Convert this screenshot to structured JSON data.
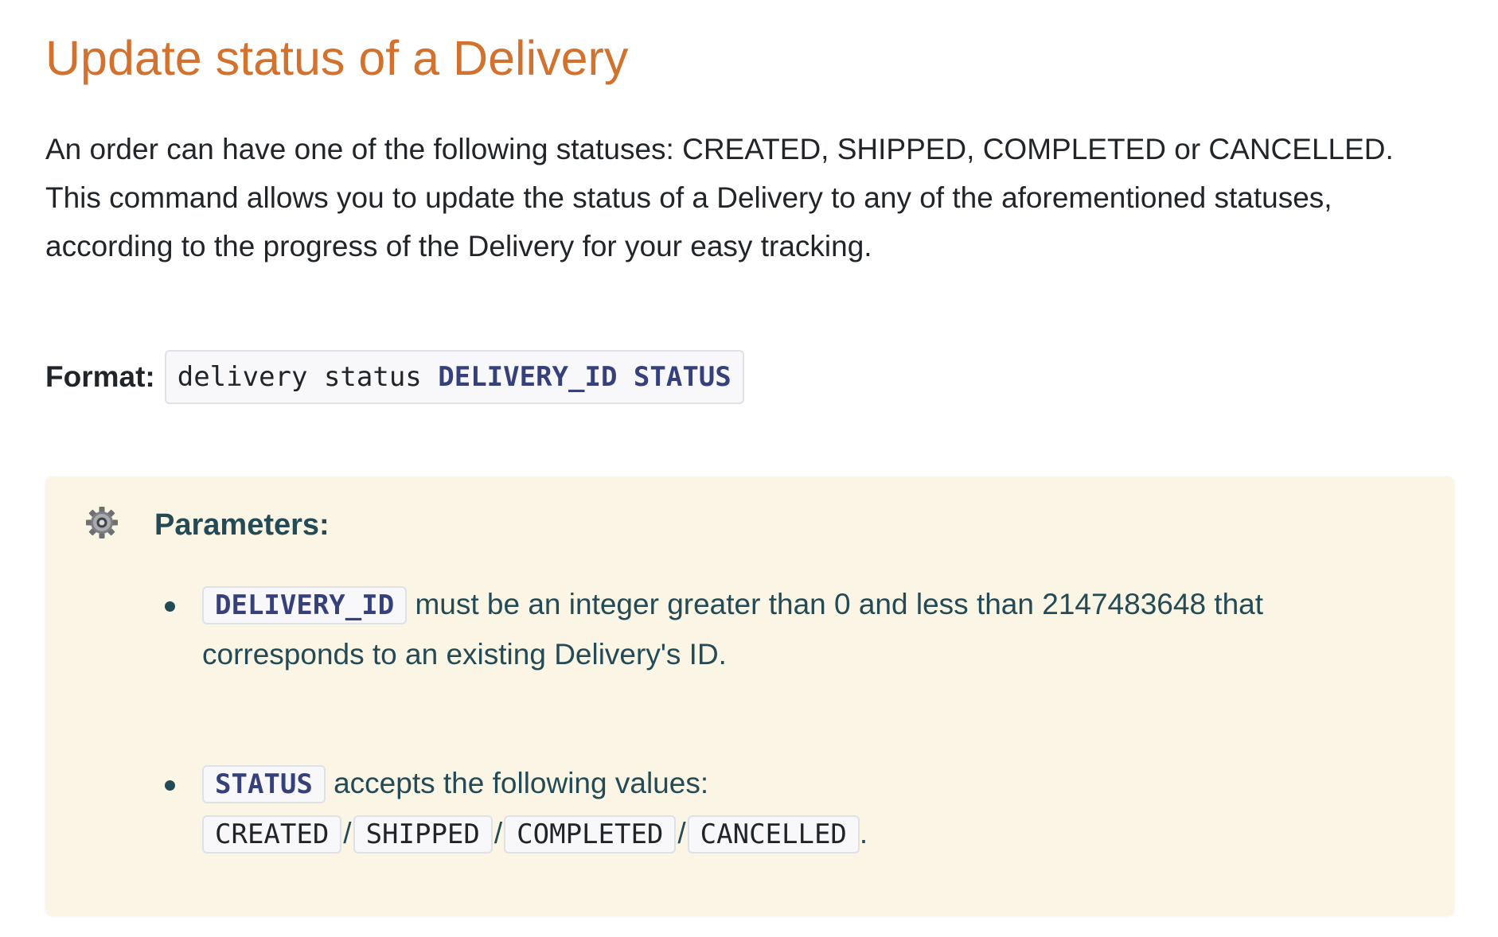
{
  "heading": "Update status of a Delivery",
  "description": "An order can have one of the following statuses: CREATED, SHIPPED, COMPLETED or CANCELLED. This command allows you to update the status of a Delivery to any of the aforementioned statuses, according to the progress of the Delivery for your easy tracking.",
  "format": {
    "label": "Format:",
    "command": "delivery status",
    "arg1": "DELIVERY_ID",
    "arg2": "STATUS"
  },
  "callout": {
    "icon": "gear-icon",
    "title": "Parameters:",
    "params": [
      {
        "name": "DELIVERY_ID",
        "text": "must be an integer greater than 0 and less than 2147483648 that corresponds to an existing Delivery's ID."
      },
      {
        "name": "STATUS",
        "text": "accepts the following values:",
        "values": [
          "CREATED",
          "SHIPPED",
          "COMPLETED",
          "CANCELLED"
        ],
        "separator": "/",
        "end": "."
      }
    ]
  },
  "colors": {
    "heading": "#d2722e",
    "callout_bg": "#faf5e4",
    "callout_text": "#244a55",
    "code_keyword": "#36407a"
  }
}
